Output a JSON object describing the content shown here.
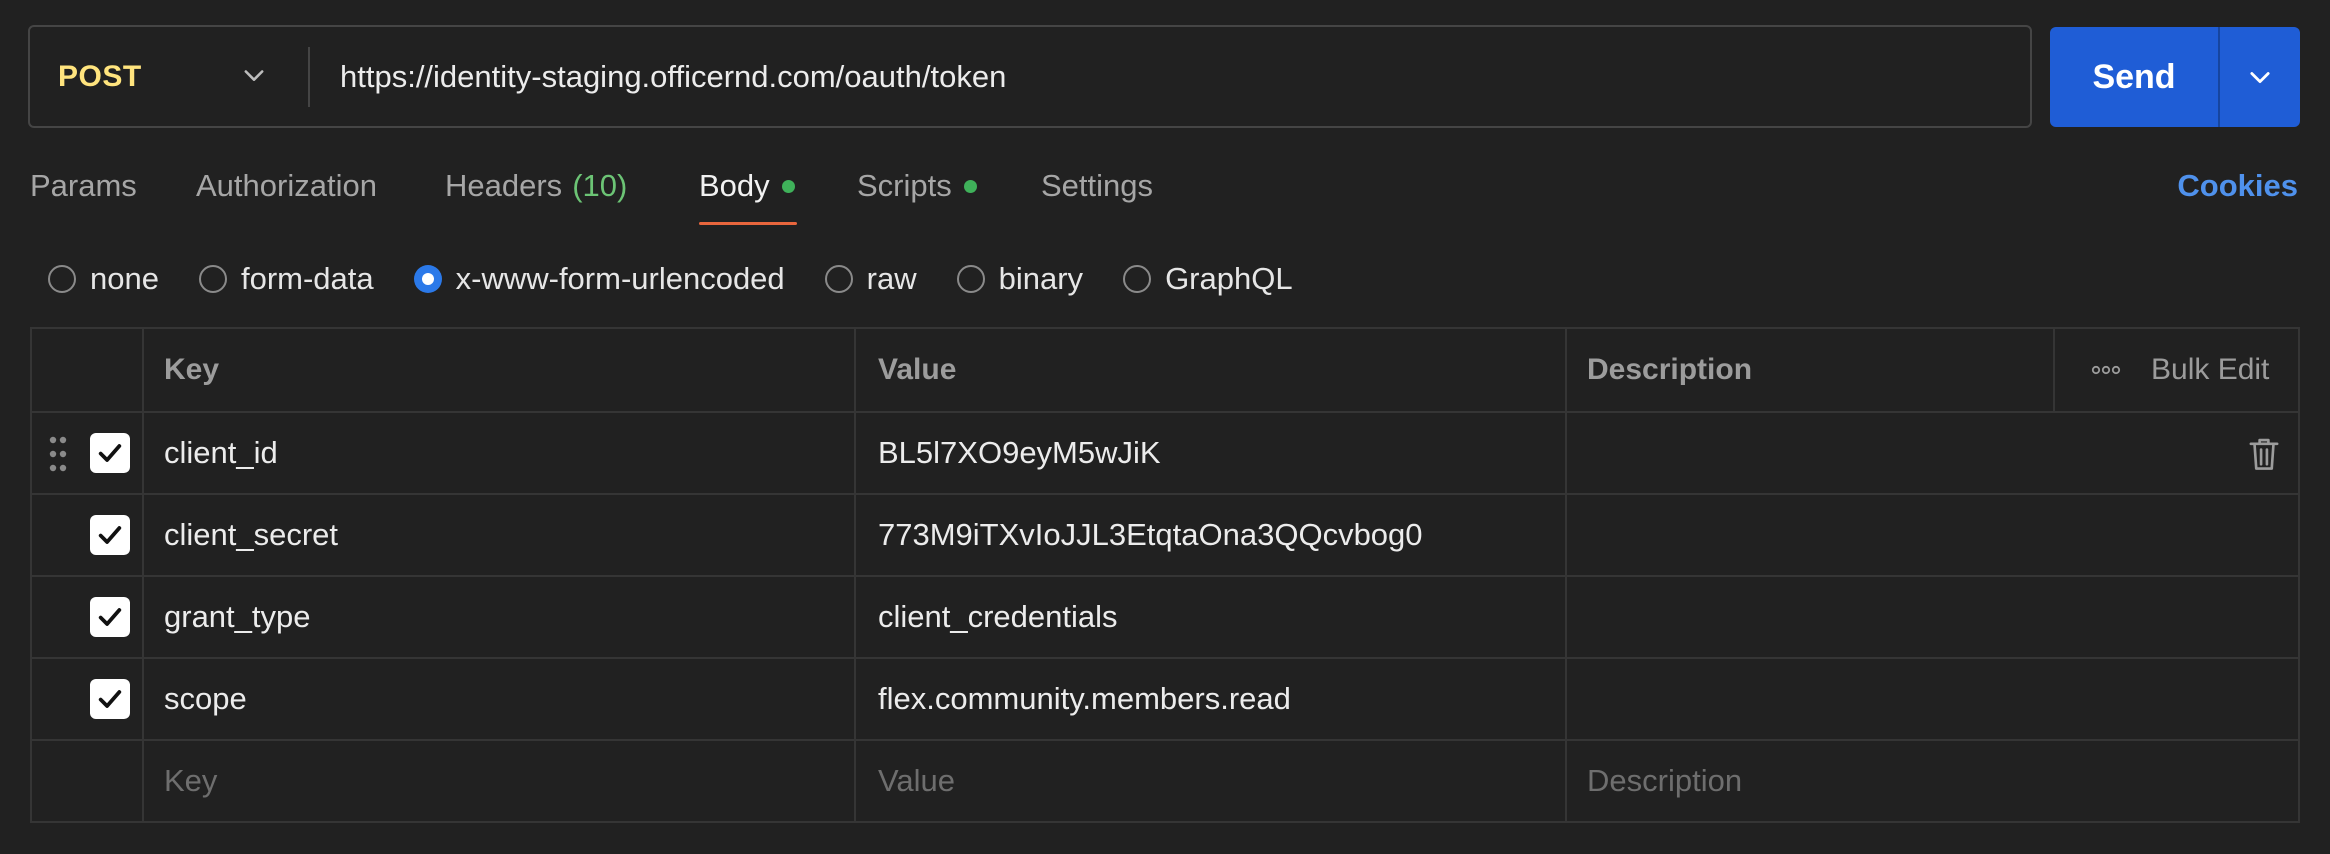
{
  "request": {
    "method": "POST",
    "url": "https://identity-staging.officernd.com/oauth/token",
    "send_label": "Send"
  },
  "tabs": [
    {
      "label": "Params"
    },
    {
      "label": "Authorization"
    },
    {
      "label": "Headers",
      "count": "(10)"
    },
    {
      "label": "Body",
      "active": true,
      "dot": true
    },
    {
      "label": "Scripts",
      "dot": true
    },
    {
      "label": "Settings"
    }
  ],
  "cookies_label": "Cookies",
  "body_types": [
    {
      "label": "none"
    },
    {
      "label": "form-data"
    },
    {
      "label": "x-www-form-urlencoded",
      "selected": true
    },
    {
      "label": "raw"
    },
    {
      "label": "binary"
    },
    {
      "label": "GraphQL"
    }
  ],
  "table": {
    "headers": {
      "key": "Key",
      "value": "Value",
      "description": "Description",
      "bulk_edit": "Bulk Edit"
    },
    "rows": [
      {
        "key": "client_id",
        "value": "BL5l7XO9eyM5wJiK",
        "description": ""
      },
      {
        "key": "client_secret",
        "value": "773M9iTXvIoJJL3EtqtaOna3QQcvbog0",
        "description": ""
      },
      {
        "key": "grant_type",
        "value": "client_credentials",
        "description": ""
      },
      {
        "key": "scope",
        "value": "flex.community.members.read",
        "description": ""
      }
    ],
    "placeholders": {
      "key": "Key",
      "value": "Value",
      "description": "Description"
    }
  },
  "colors": {
    "method": "#ffe47e",
    "send": "#1f5dd6",
    "accent_tab": "#e8663d",
    "link": "#4f91ec",
    "dot": "#3fb15a",
    "radio_selected": "#2b79e9"
  }
}
